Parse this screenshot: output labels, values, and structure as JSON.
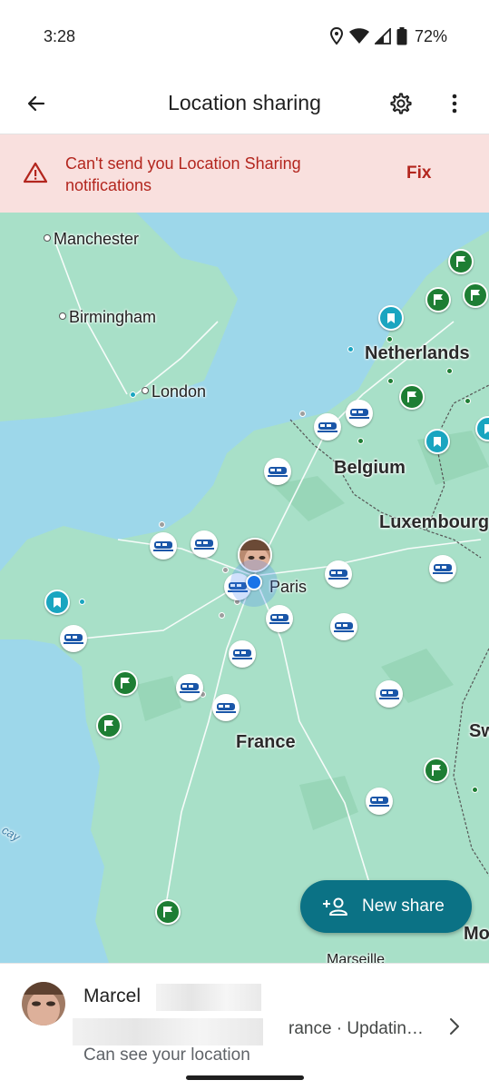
{
  "status_bar": {
    "time": "3:28",
    "battery": "72%",
    "icons": [
      "location-icon",
      "wifi-icon",
      "signal-icon",
      "battery-icon"
    ]
  },
  "app_bar": {
    "title": "Location sharing",
    "back_icon": "arrow-back-icon",
    "settings_icon": "gear-icon",
    "more_icon": "more-vert-icon"
  },
  "banner": {
    "text": "Can't send you Location Sharing notifications",
    "action": "Fix",
    "icon": "warning-icon",
    "color": "#b3261e"
  },
  "map": {
    "labels": {
      "manchester": "Manchester",
      "birmingham": "Birmingham",
      "london": "London",
      "netherlands": "Netherlands",
      "belgium": "Belgium",
      "luxembourg": "Luxembourg",
      "paris": "Paris",
      "france": "France",
      "switzerland_partial": "Sw",
      "monaco_partial": "Mo",
      "marseille_partial": "Marseille",
      "biscay_partial": "cay"
    },
    "colors": {
      "sea": "#9dd7ea",
      "land": "#a8e0c8",
      "train_poi": "#1a56a8",
      "flag_poi": "#1e7e34",
      "pin_poi": "#1aa5c0"
    }
  },
  "fab": {
    "label": "New share",
    "icon": "person-add-icon",
    "color": "#0b7285"
  },
  "contact": {
    "name": "Marcel",
    "status": "rance · Updatin…",
    "subtitle": "Can see your location"
  }
}
